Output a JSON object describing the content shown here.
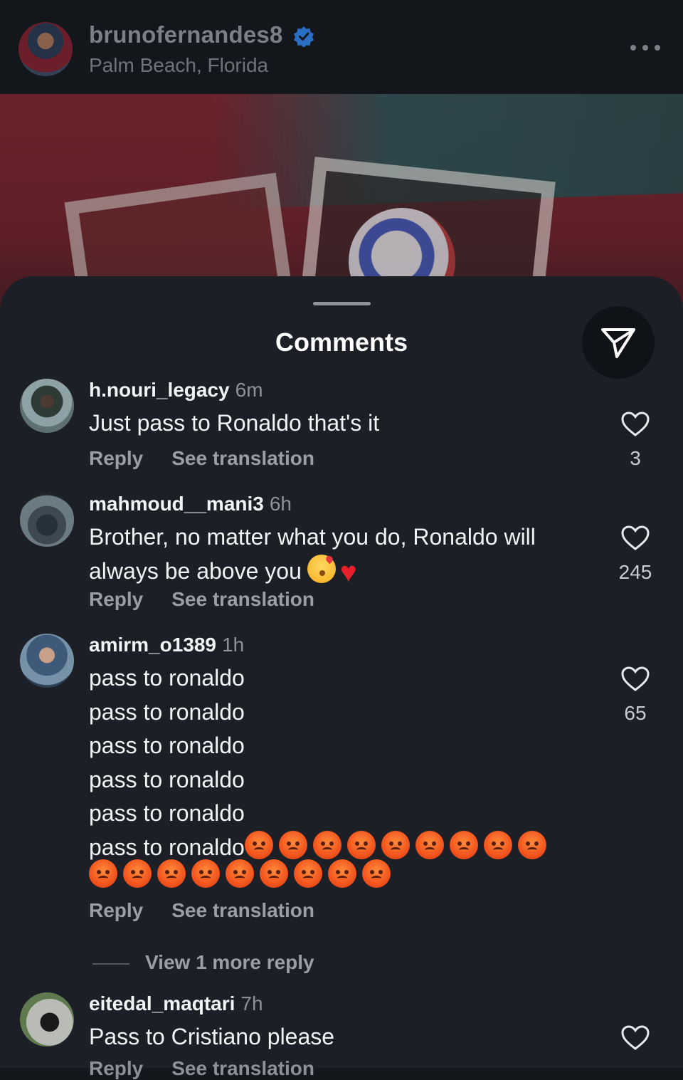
{
  "post": {
    "username": "brunofernandes8",
    "location": "Palm Beach, Florida"
  },
  "sheet": {
    "title": "Comments"
  },
  "actions": {
    "reply": "Reply",
    "see_translation": "See translation"
  },
  "comments": [
    {
      "username": "h.nouri_legacy",
      "time": "6m",
      "lines": [
        "Just pass  to Ronaldo that's it"
      ],
      "likes": "3"
    },
    {
      "username": "mahmoud__mani3",
      "time": "6h",
      "lines": [
        "Brother, no matter what you do, Ronaldo will",
        "always be above you"
      ],
      "likes": "245"
    },
    {
      "username": "amirm_o1389",
      "time": "1h",
      "lines": [
        "pass to ronaldo",
        "pass to ronaldo",
        "pass to ronaldo",
        "pass to ronaldo",
        "pass to ronaldo",
        "pass to ronaldo"
      ],
      "likes": "65",
      "view_more_replies": "View 1 more reply"
    },
    {
      "username": "eitedal_maqtari",
      "time": "7h",
      "lines": [
        "Pass to Cristiano please"
      ],
      "likes": ""
    }
  ],
  "icons": {
    "verified": "verified-badge-icon",
    "more": "more-options-icon",
    "share": "send-icon",
    "like": "heart-outline-icon",
    "emoji_angry": "angry-face-emoji",
    "emoji_kiss": "face-blowing-kiss-emoji",
    "emoji_heart": "red-heart-emoji"
  },
  "colors": {
    "background": "#14181d",
    "sheet": "#1c2026",
    "verified": "#2f7fe0"
  }
}
